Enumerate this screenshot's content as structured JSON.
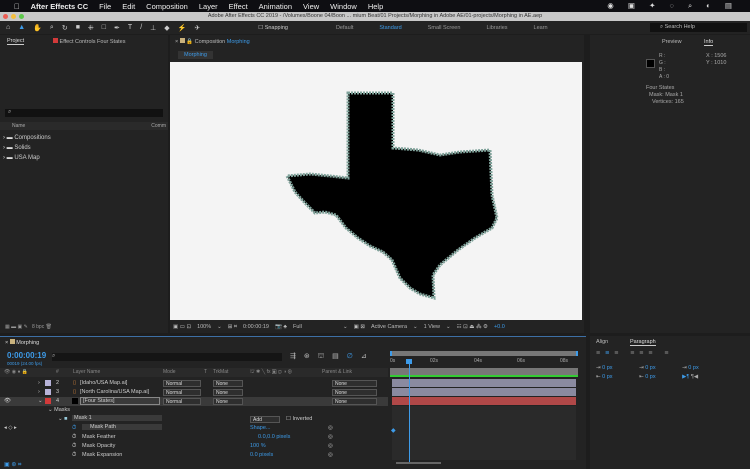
{
  "menubar": {
    "app": "After Effects CC",
    "items": [
      "File",
      "Edit",
      "Composition",
      "Layer",
      "Effect",
      "Animation",
      "View",
      "Window",
      "Help"
    ]
  },
  "titlebar": {
    "title": "Adobe After Effects CC 2019 - /Volumes/Boone 04/Boon ... mium Beat/01 Projects/Morphing in Adobe AE/01-projects/Morphing in AE.aep"
  },
  "toolbar": {
    "snapping": "Snapping",
    "workspaces": [
      "Default",
      "Standard",
      "Small Screen",
      "Libraries",
      "Learn"
    ],
    "active_workspace": "Standard",
    "search_placeholder": "Search Help"
  },
  "project": {
    "tab": "Project",
    "effect_tab": "Effect Controls Four States",
    "col_name": "Name",
    "col_comment": "Comm",
    "items": [
      "Compositions",
      "Solids",
      "USA Map"
    ],
    "bpc": "8 bpc"
  },
  "viewer": {
    "tab_prefix": "Composition",
    "tab_name": "Morphing",
    "subtab": "Morphing",
    "zoom": "100%",
    "time": "0:00:00:19",
    "resolution": "Full",
    "camera": "Active Camera",
    "views": "1 View",
    "exposure": "+0.0"
  },
  "info": {
    "tabs": [
      "Preview",
      "Info"
    ],
    "r": "R :",
    "g": "G :",
    "b": "B :",
    "a": "A :  0",
    "x": "X : 1506",
    "y": "Y : 1010",
    "layer": "Four States",
    "mask": "Mask: Mask 1",
    "vertices": "Vertices: 165"
  },
  "timeline": {
    "tab": "Morphing",
    "time": "0:00:00:19",
    "frames": "00019 (24.00 fps)",
    "headers": {
      "num": "#",
      "layer_name": "Layer Name",
      "mode": "Mode",
      "t": "T",
      "trkmat": "TrkMat",
      "parent": "Parent & Link"
    },
    "ruler": [
      "0s",
      "02s",
      "04s",
      "06s",
      "08s"
    ],
    "layers": [
      {
        "num": "2",
        "name": "[Idaho/USA Map.ai]",
        "mode": "Normal",
        "trkmat": "None",
        "parent": "None",
        "color": "#b7b3d9"
      },
      {
        "num": "3",
        "name": "[North Carolina/USA Map.ai]",
        "mode": "Normal",
        "trkmat": "None",
        "parent": "None",
        "color": "#b7b3d9"
      },
      {
        "num": "4",
        "name": "[Four States]",
        "mode": "Normal",
        "trkmat": "None",
        "parent": "None",
        "color": "#d23a3a"
      }
    ],
    "masks_label": "Masks",
    "mask_name": "Mask 1",
    "mask_mode": "Add",
    "inverted": "Inverted",
    "props": [
      {
        "name": "Mask Path",
        "value": "Shape..."
      },
      {
        "name": "Mask Feather",
        "value": "0.0,0.0 pixels"
      },
      {
        "name": "Mask Opacity",
        "value": "100 %"
      },
      {
        "name": "Mask Expansion",
        "value": "0.0 pixels"
      }
    ]
  },
  "paragraph": {
    "tabs": [
      "Align",
      "Paragraph"
    ],
    "values": [
      "0 px",
      "0 px",
      "0 px",
      "0 px",
      "0 px"
    ]
  }
}
